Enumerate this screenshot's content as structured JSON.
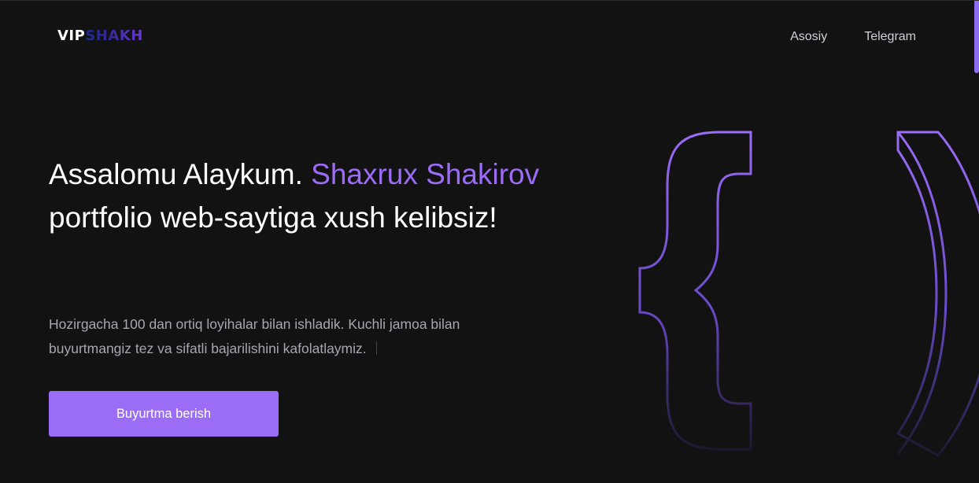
{
  "header": {
    "logo": {
      "part1": "VIP",
      "part2": "SHAKH"
    },
    "nav": [
      {
        "label": "Asosiy"
      },
      {
        "label": "Telegram"
      }
    ]
  },
  "hero": {
    "title_part1": "Assalomu Alaykum. ",
    "title_accent": "Shaxrux Shakirov",
    "title_part2": " portfolio web-saytiga xush kelibsiz!",
    "description": "Hozirgacha 100 dan ortiq loyihalar bilan ishladik. Kuchli jamoa bilan buyurtmangiz tez va sifatli bajarilishini kafolatlaymiz.",
    "cta_label": "Buyurtma berish"
  },
  "decoration": {
    "icon": "curly-brace-code-icon"
  },
  "colors": {
    "background": "#121212",
    "accent": "#9b6cf5",
    "nav_text": "#cfcfd6",
    "description_text": "#a7a7b0"
  }
}
